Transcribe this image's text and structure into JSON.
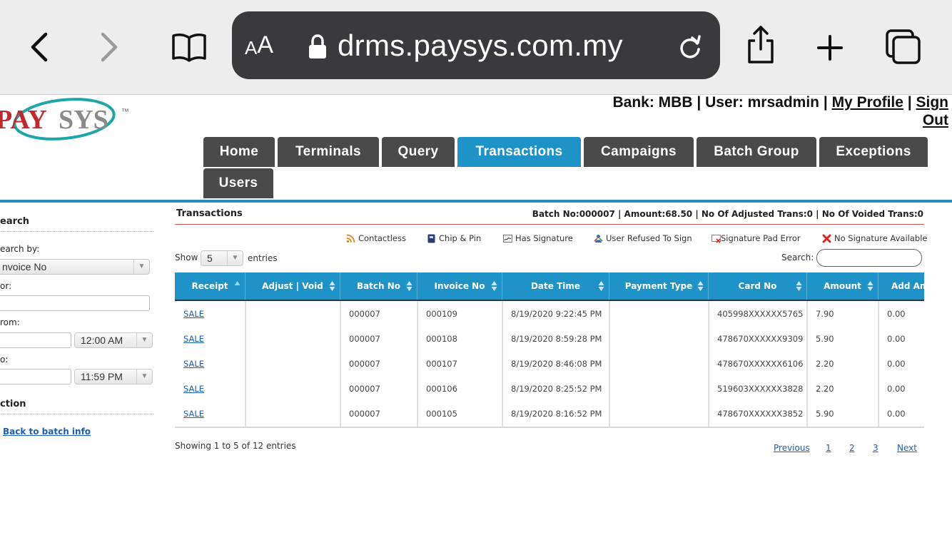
{
  "browser": {
    "aa_small": "A",
    "aa_big": "A",
    "url": "drms.paysys.com.my",
    "icons": [
      "chevron-left-icon",
      "chevron-right-icon",
      "book-icon",
      "lock-icon",
      "reload-icon",
      "share-icon",
      "plus-icon",
      "tabs-icon"
    ]
  },
  "header": {
    "logo_text": "PAYSYS",
    "logo_mark": "™",
    "bank_label": "Bank: MBB",
    "sep": "|",
    "user_label": "User: mrsadmin",
    "my_profile": "My Profile",
    "sign_out_1": "Sign",
    "sign_out_2": "Out"
  },
  "nav": {
    "tabs": [
      {
        "label": "Home",
        "active": false
      },
      {
        "label": "Terminals",
        "active": false
      },
      {
        "label": "Query",
        "active": false
      },
      {
        "label": "Transactions",
        "active": true
      },
      {
        "label": "Campaigns",
        "active": false
      },
      {
        "label": "Batch Group",
        "active": false
      },
      {
        "label": "Exceptions",
        "active": false
      },
      {
        "label": "Users",
        "active": false
      }
    ]
  },
  "sidebar": {
    "search_title": "earch",
    "search_by_label": "earch by:",
    "search_by_value": "nvoice No",
    "for_label": "or:",
    "from_label": "rom:",
    "from_time": "12:00 AM",
    "to_label": "o:",
    "to_time": "11:59 PM",
    "action_title": "ction",
    "back_link": "Back to batch info"
  },
  "main": {
    "title": "Transactions",
    "batch_summary": "Batch No:000007 | Amount:68.50 | No Of Adjusted Trans:0 | No Of Voided Trans:0",
    "legend": [
      {
        "icon": "contactless-icon",
        "label": "Contactless"
      },
      {
        "icon": "chip-pin-icon",
        "label": "Chip & Pin"
      },
      {
        "icon": "signature-icon",
        "label": "Has Signature"
      },
      {
        "icon": "refused-sign-icon",
        "label": "User Refused To Sign"
      },
      {
        "icon": "pad-error-icon",
        "label": "Signature Pad Error"
      },
      {
        "icon": "no-signature-icon",
        "label": "No Signature Available"
      }
    ],
    "show_label": "Show",
    "show_value": "5",
    "entries_label": "entries",
    "search_label": "Search:",
    "search_value": ""
  },
  "table": {
    "columns": [
      "Receipt",
      "Adjust | Void",
      "Batch No",
      "Invoice No",
      "Date Time",
      "Payment Type",
      "Card No",
      "Amount",
      "Add Am"
    ],
    "rows": [
      [
        "SALE",
        "",
        "000007",
        "000109",
        "8/19/2020 9:22:45 PM",
        "",
        "405998XXXXXX5765",
        "7.90",
        "0.00"
      ],
      [
        "SALE",
        "",
        "000007",
        "000108",
        "8/19/2020 8:59:28 PM",
        "",
        "478670XXXXXX9309",
        "5.90",
        "0.00"
      ],
      [
        "SALE",
        "",
        "000007",
        "000107",
        "8/19/2020 8:46:08 PM",
        "",
        "478670XXXXXX6106",
        "2.20",
        "0.00"
      ],
      [
        "SALE",
        "",
        "000007",
        "000106",
        "8/19/2020 8:25:52 PM",
        "",
        "519603XXXXXX3828",
        "2.20",
        "0.00"
      ],
      [
        "SALE",
        "",
        "000007",
        "000105",
        "8/19/2020 8:16:52 PM",
        "",
        "478670XXXXXX3852",
        "5.90",
        "0.00"
      ]
    ]
  },
  "footer": {
    "showing": "Showing 1 to 5 of 12 entries",
    "previous": "Previous",
    "pages": [
      "1",
      "2",
      "3"
    ],
    "next": "Next"
  }
}
